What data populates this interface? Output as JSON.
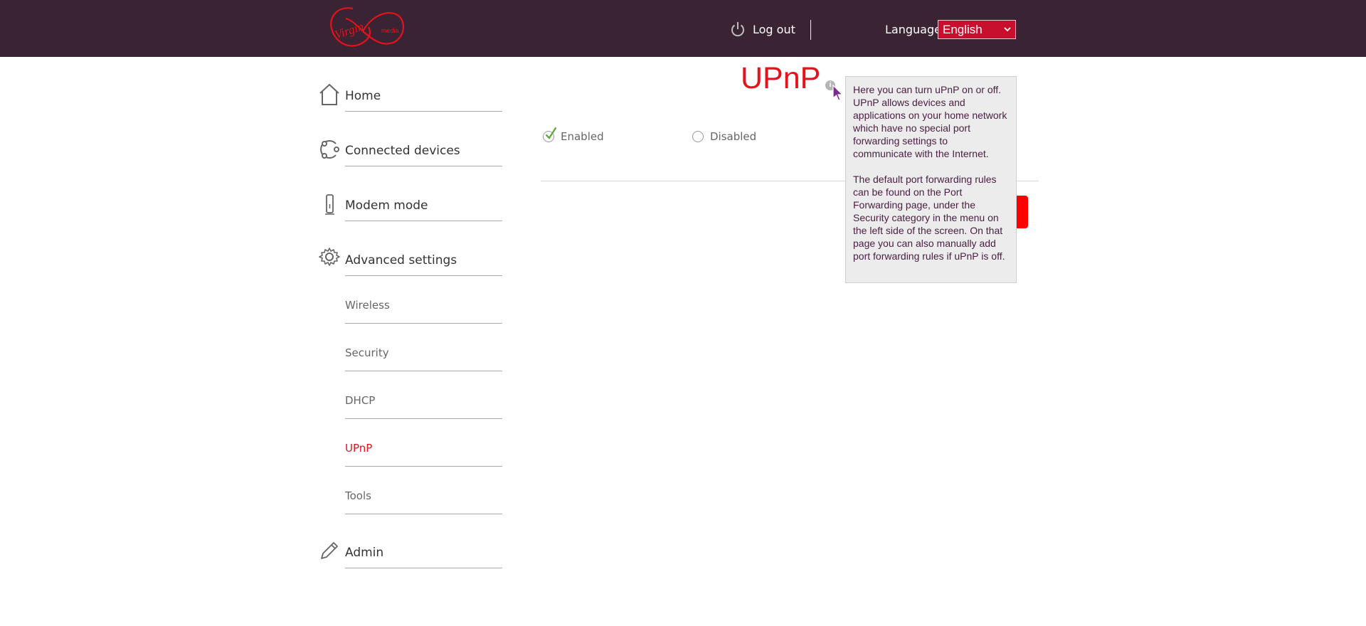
{
  "header": {
    "brand": "Virgin media",
    "logout_label": "Log out",
    "language_label": "Language",
    "language_selected": "English",
    "colors": {
      "bar": "#3a2332",
      "accent": "#c8102e"
    }
  },
  "sidebar": {
    "main_items": [
      {
        "label": "Home",
        "icon": "home-icon"
      },
      {
        "label": "Connected devices",
        "icon": "connected-devices-icon"
      },
      {
        "label": "Modem mode",
        "icon": "modem-icon"
      },
      {
        "label": "Advanced settings",
        "icon": "gear-icon"
      },
      {
        "label": "Admin",
        "icon": "pencil-icon"
      }
    ],
    "sub_items": [
      {
        "label": "Wireless",
        "active": false
      },
      {
        "label": "Security",
        "active": false
      },
      {
        "label": "DHCP",
        "active": false
      },
      {
        "label": "UPnP",
        "active": true
      },
      {
        "label": "Tools",
        "active": false
      }
    ]
  },
  "main": {
    "title": "UPnP",
    "info_icon": "info-icon",
    "options": [
      {
        "label": "Enabled",
        "selected": true
      },
      {
        "label": "Disabled",
        "selected": false
      }
    ]
  },
  "tooltip": {
    "paragraph1": "Here you can turn uPnP on or off. UPnP allows devices and applications on your home network which have no special port forwarding settings to communicate with the Internet.",
    "paragraph2": "The default port forwarding rules can be found on the Port Forwarding page, under the Security category in the menu on the left side of the screen. On that page you can also manually add port forwarding rules if uPnP is off."
  }
}
